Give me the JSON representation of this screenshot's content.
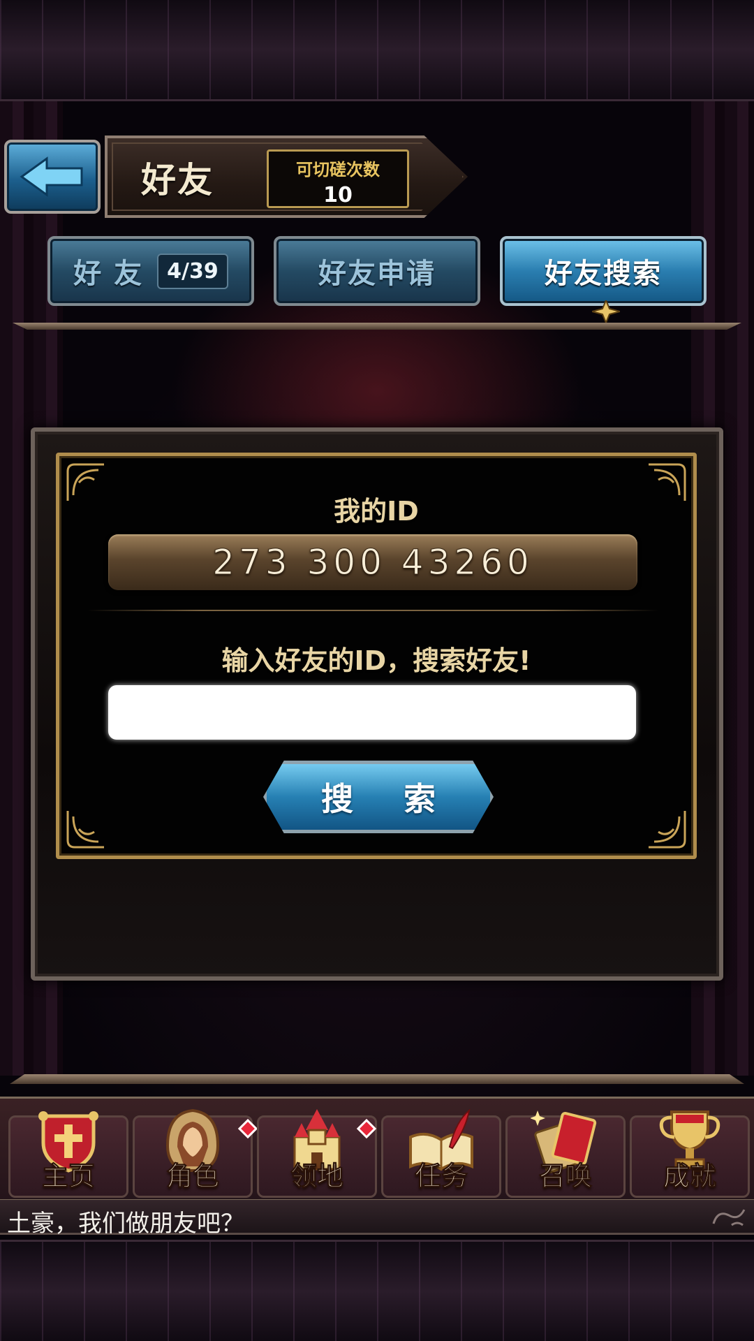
{
  "header": {
    "title": "好友",
    "counter_label": "可切磋次数",
    "counter_value": "10"
  },
  "tabs": [
    {
      "label": "好 友",
      "count": "4/39",
      "active": false
    },
    {
      "label": "好友申请",
      "active": false
    },
    {
      "label": "好友搜索",
      "active": true
    }
  ],
  "panel": {
    "my_id_label": "我的ID",
    "my_id_value": "273 300 43260",
    "search_prompt": "输入好友的ID，搜索好友!",
    "search_input_value": "",
    "search_button": "搜 索"
  },
  "bottom_nav": [
    {
      "label": "主页",
      "icon": "shield-cross-icon",
      "badge": false
    },
    {
      "label": "角色",
      "icon": "hooded-character-icon",
      "badge": true
    },
    {
      "label": "领地",
      "icon": "castle-icon",
      "badge": true
    },
    {
      "label": "任务",
      "icon": "book-quill-icon",
      "badge": false
    },
    {
      "label": "召唤",
      "icon": "cards-icon",
      "badge": false
    },
    {
      "label": "成就",
      "icon": "trophy-icon",
      "badge": false
    }
  ],
  "chat": {
    "message": "土豪，我们做朋友吧？"
  },
  "colors": {
    "accent_blue": "#2a7eb0",
    "gold_border": "#b08d4c",
    "badge_red": "#e8263a"
  }
}
